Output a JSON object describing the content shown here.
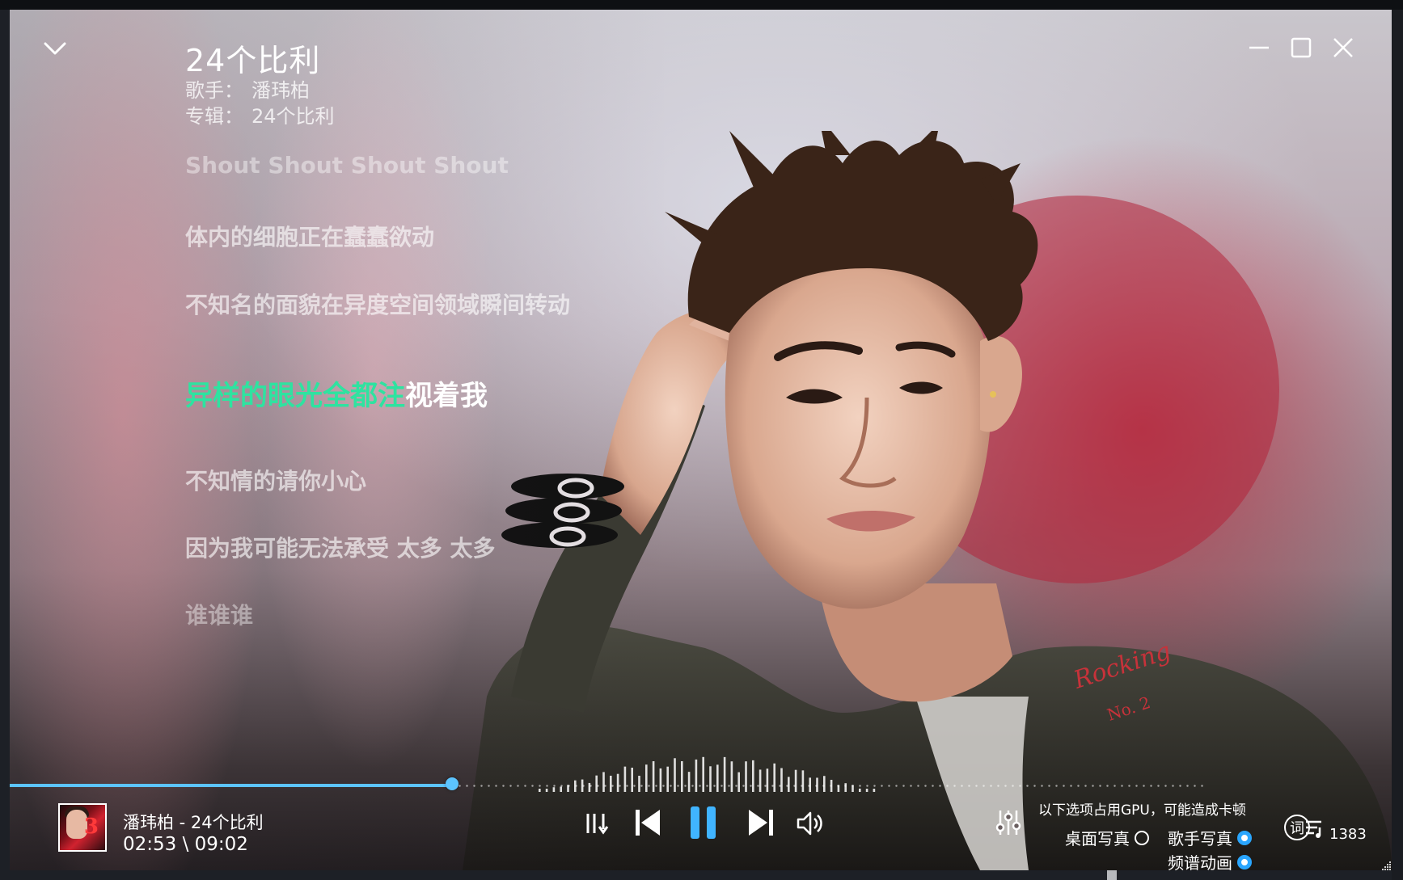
{
  "window": {
    "collapse_icon": "chevron-down-icon",
    "minimize_icon": "minimize-icon",
    "maximize_icon": "maximize-icon",
    "close_icon": "close-icon"
  },
  "song": {
    "title": "24个比利",
    "artist_label": "歌手：",
    "artist": "潘玮柏",
    "album_label": "专辑：",
    "album": "24个比利"
  },
  "lyrics": {
    "lines": [
      "Shout Shout Shout Shout",
      "体内的细胞正在蠢蠢欲动",
      "不知名的面貌在异度空间领域瞬间转动",
      "不知情的请你小心",
      "因为我可能无法承受 太多 太多",
      "谁谁谁"
    ],
    "current_sung": "异样的眼光全都注",
    "current_rest": "视着我"
  },
  "player": {
    "now_playing": "潘玮柏 - 24个比利",
    "time": "02:53 \\ 09:02",
    "progress": 0.32,
    "accent": "#5cc4ff",
    "lyric_highlight": "#2ee3a0"
  },
  "controls": {
    "mode_icon": "playlist-order-icon",
    "prev_icon": "previous-track-icon",
    "play_pause_icon": "pause-icon",
    "next_icon": "next-track-icon",
    "volume_icon": "volume-icon",
    "equalizer_icon": "equalizer-icon",
    "lyrics_icon": "lyrics-icon",
    "playlist_icon": "playlist-icon"
  },
  "options": {
    "gpu_note": "以下选项占用GPU，可能造成卡顿",
    "desktop_photo": "桌面写真",
    "artist_photo": "歌手写真",
    "spectrum_anim": "频谱动画",
    "desktop_photo_on": false,
    "artist_photo_on": true,
    "spectrum_anim_on": true
  },
  "lyrics_button": "词",
  "playlist_count": "1383"
}
